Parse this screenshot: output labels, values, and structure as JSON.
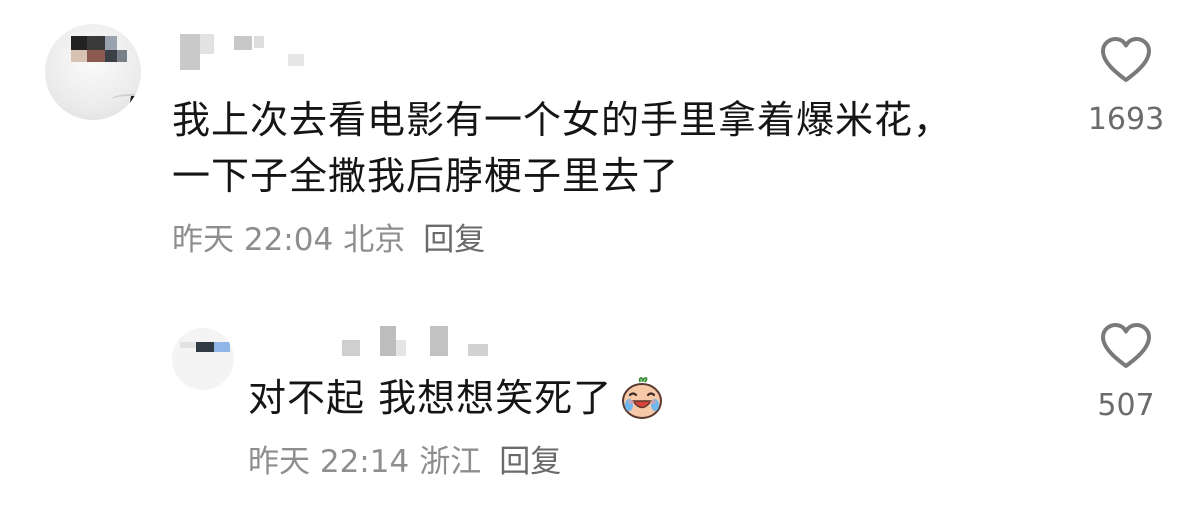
{
  "comments": [
    {
      "text_lines": [
        "我上次去看电影有一个女的手里拿着爆米花，",
        "一下子全撒我后脖梗子里去了"
      ],
      "time": "昨天 22:04",
      "location": "北京",
      "reply_label": "回复",
      "likes": "1693",
      "icons": {
        "like": "heart-outline-icon"
      }
    },
    {
      "text": "对不起 我想想笑死了",
      "emoji": "crying-laughing-face-icon",
      "time": "昨天 22:14",
      "location": "浙江",
      "reply_label": "回复",
      "likes": "507",
      "icons": {
        "like": "heart-outline-icon"
      }
    }
  ],
  "colors": {
    "text": "#151515",
    "meta": "#8e8e8e",
    "like_count": "#6b6b6b",
    "background": "#ffffff"
  }
}
